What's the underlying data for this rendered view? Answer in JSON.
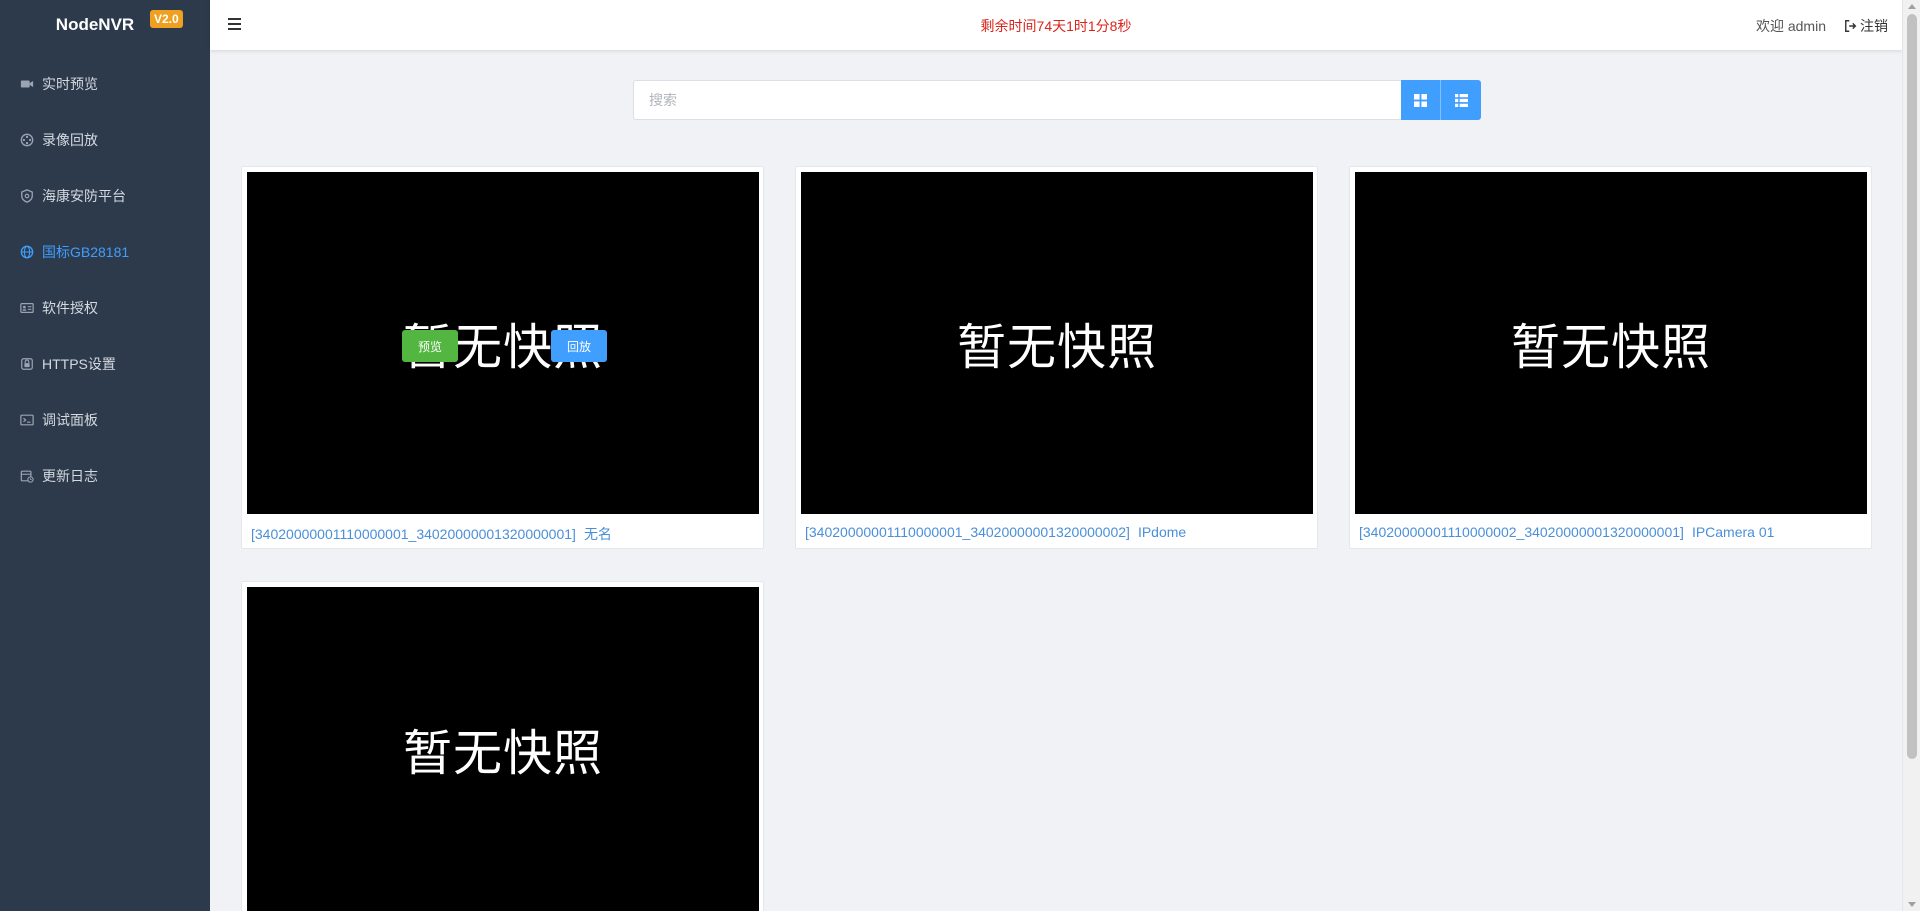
{
  "app": {
    "name": "NodeNVR",
    "version": "V2.0"
  },
  "sidebar": {
    "items": [
      {
        "label": "实时预览",
        "icon": "video-camera-icon",
        "active": false
      },
      {
        "label": "录像回放",
        "icon": "film-reel-icon",
        "active": false
      },
      {
        "label": "海康安防平台",
        "icon": "shield-icon",
        "active": false
      },
      {
        "label": "国标GB28181",
        "icon": "globe-icon",
        "active": true
      },
      {
        "label": "软件授权",
        "icon": "id-card-icon",
        "active": false
      },
      {
        "label": "HTTPS设置",
        "icon": "lock-icon",
        "active": false
      },
      {
        "label": "调试面板",
        "icon": "terminal-icon",
        "active": false
      },
      {
        "label": "更新日志",
        "icon": "calendar-log-icon",
        "active": false
      }
    ]
  },
  "header": {
    "remaining": "剩余时间74天1时1分8秒",
    "welcome": "欢迎 admin",
    "logout": "注销"
  },
  "search": {
    "placeholder": "搜索"
  },
  "cards": [
    {
      "snapshot_text": "暂无快照",
      "id": "[34020000001110000001_34020000001320000001]",
      "name": "无名",
      "hovered": true
    },
    {
      "snapshot_text": "暂无快照",
      "id": "[34020000001110000001_34020000001320000002]",
      "name": "IPdome",
      "hovered": false
    },
    {
      "snapshot_text": "暂无快照",
      "id": "[34020000001110000002_34020000001320000001]",
      "name": "IPCamera 01",
      "hovered": false
    },
    {
      "snapshot_text": "暂无快照",
      "id": "",
      "name": "",
      "hovered": false
    }
  ],
  "overlay": {
    "preview": "预览",
    "playback": "回放"
  },
  "colors": {
    "sidebar_bg": "#2d3a4b",
    "accent": "#409eff",
    "preview_green": "#52b640",
    "remaining_red": "#d9261c",
    "version_badge": "#f0a020"
  }
}
